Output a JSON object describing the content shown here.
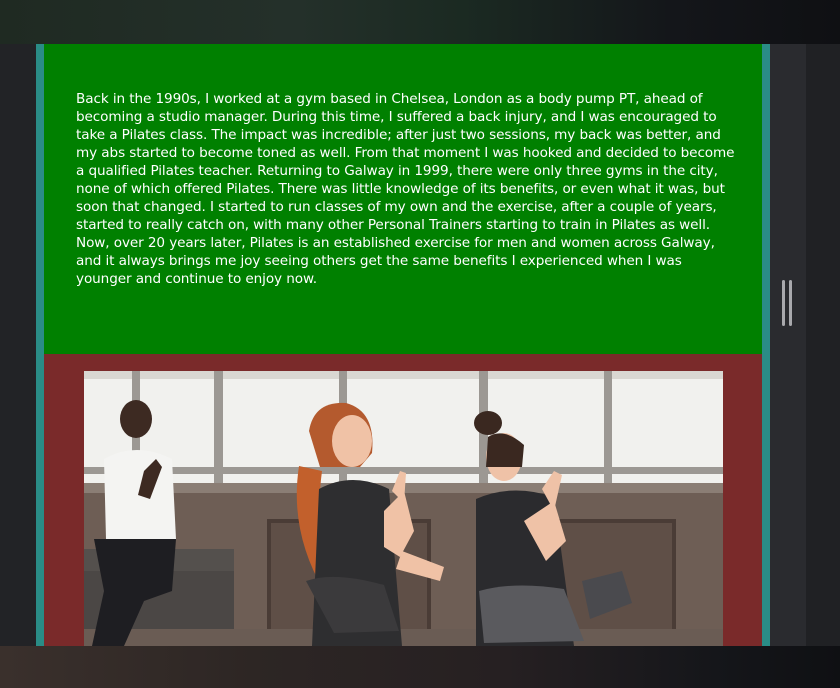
{
  "about": {
    "paragraph": "Back in the 1990s, I worked at a gym based in Chelsea, London as a body pump PT, ahead of becoming a studio manager. During this time, I suffered a back injury, and I was encouraged to take a Pilates class. The impact was incredible; after just two sessions, my back was better, and my abs started to become toned as well. From that moment I was hooked and decided to become a qualified Pilates teacher. Returning to Galway in 1999, there were only three gyms in the city, none of which offered Pilates. There was little knowledge of its benefits, or even what it was, but soon that changed. I started to run classes of my own and the exercise, after a couple of years, started to really catch on, with many other Personal Trainers starting to train in Pilates as well. Now, over 20 years later, Pilates is an established exercise for men and women across Galway, and it always brings me joy seeing others get the same benefits I experienced when I was younger and continue to enjoy now."
  },
  "colors": {
    "about_background": "#008000",
    "gallery_background": "#7a2a2a",
    "page_border": "#2a8c86"
  },
  "gallery": {
    "photo_icon": "pilates-class-photo"
  }
}
